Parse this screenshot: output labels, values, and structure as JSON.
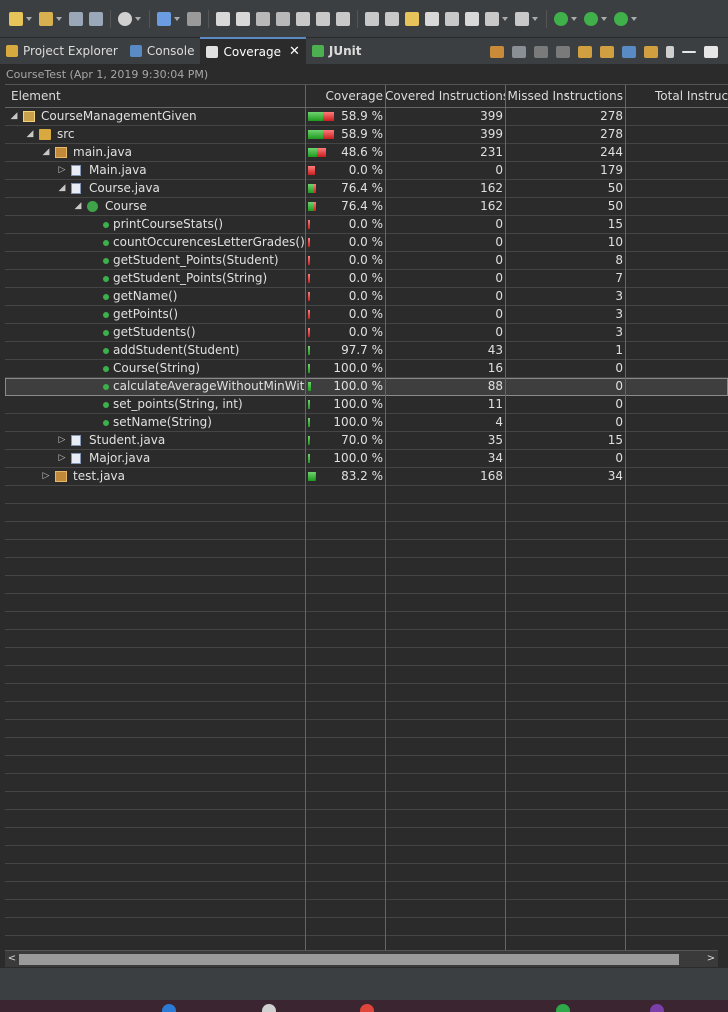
{
  "toolbar": {
    "icons": [
      "new-icon",
      "new-package-icon",
      "save-icon",
      "save-all-icon",
      "user-icon",
      "console-icon",
      "skip-breakpoints-icon",
      "resume-icon",
      "suspend-icon",
      "terminate-icon",
      "disconnect-icon",
      "step-into-icon",
      "step-over-icon",
      "step-return-icon",
      "toggle-source-icon",
      "open-task-icon",
      "toggle-mark-icon",
      "edit-icon",
      "external-tools-icon",
      "open-type-icon",
      "open-file-icon",
      "whitespace-icon",
      "run-coverage-icon",
      "run-icon",
      "debug-icon"
    ]
  },
  "tabs": [
    {
      "label": "Project Explorer",
      "icon": "project-explorer-icon",
      "color": "#d7a93f",
      "active": false
    },
    {
      "label": "Console",
      "icon": "console-icon",
      "color": "#5a8ac6",
      "active": false
    },
    {
      "label": "Coverage",
      "icon": "coverage-icon",
      "color": "#e0e0e0",
      "active": true,
      "close": "✕"
    },
    {
      "label": "JUnit",
      "icon": "junit-icon",
      "color": "#4caf50",
      "active": false
    }
  ],
  "session": "CourseTest (Apr 1, 2019 9:30:04 PM)",
  "columns": {
    "element": "Element",
    "coverage": "Coverage",
    "covered": "Covered Instructions",
    "missed": "Missed Instructions",
    "total": "Total Instruc"
  },
  "colors": {
    "covered": "#2ea82e",
    "missed": "#e03c3c",
    "selection": "#3e3e3e"
  },
  "rows": [
    {
      "name": "CourseManagementGiven",
      "level": 0,
      "expander": "expanded",
      "icon": "project",
      "coverage": "58.9 %",
      "covered": "399",
      "missed": "278",
      "selected": false
    },
    {
      "name": "src",
      "level": 1,
      "expander": "expanded",
      "icon": "folder",
      "coverage": "58.9 %",
      "covered": "399",
      "missed": "278",
      "selected": false
    },
    {
      "name": "main.java",
      "level": 2,
      "expander": "expanded",
      "icon": "package",
      "coverage": "48.6 %",
      "covered": "231",
      "missed": "244",
      "selected": false
    },
    {
      "name": "Main.java",
      "level": 3,
      "expander": "collapsed",
      "icon": "file",
      "coverage": "0.0 %",
      "covered": "0",
      "missed": "179",
      "selected": false
    },
    {
      "name": "Course.java",
      "level": 3,
      "expander": "expanded",
      "icon": "file",
      "coverage": "76.4 %",
      "covered": "162",
      "missed": "50",
      "selected": false
    },
    {
      "name": "Course",
      "level": 4,
      "expander": "expanded",
      "icon": "class",
      "coverage": "76.4 %",
      "covered": "162",
      "missed": "50",
      "selected": false
    },
    {
      "name": "printCourseStats()",
      "level": 5,
      "expander": "none",
      "icon": "method",
      "coverage": "0.0 %",
      "covered": "0",
      "missed": "15",
      "selected": false
    },
    {
      "name": "countOccurencesLetterGrades()",
      "level": 5,
      "expander": "none",
      "icon": "method",
      "coverage": "0.0 %",
      "covered": "0",
      "missed": "10",
      "selected": false
    },
    {
      "name": "getStudent_Points(Student)",
      "level": 5,
      "expander": "none",
      "icon": "method",
      "coverage": "0.0 %",
      "covered": "0",
      "missed": "8",
      "selected": false
    },
    {
      "name": "getStudent_Points(String)",
      "level": 5,
      "expander": "none",
      "icon": "method",
      "coverage": "0.0 %",
      "covered": "0",
      "missed": "7",
      "selected": false
    },
    {
      "name": "getName()",
      "level": 5,
      "expander": "none",
      "icon": "method",
      "coverage": "0.0 %",
      "covered": "0",
      "missed": "3",
      "selected": false
    },
    {
      "name": "getPoints()",
      "level": 5,
      "expander": "none",
      "icon": "method",
      "coverage": "0.0 %",
      "covered": "0",
      "missed": "3",
      "selected": false
    },
    {
      "name": "getStudents()",
      "level": 5,
      "expander": "none",
      "icon": "method",
      "coverage": "0.0 %",
      "covered": "0",
      "missed": "3",
      "selected": false
    },
    {
      "name": "addStudent(Student)",
      "level": 5,
      "expander": "none",
      "icon": "method",
      "coverage": "97.7 %",
      "covered": "43",
      "missed": "1",
      "selected": false
    },
    {
      "name": "Course(String)",
      "level": 5,
      "expander": "none",
      "icon": "method",
      "coverage": "100.0 %",
      "covered": "16",
      "missed": "0",
      "selected": false
    },
    {
      "name": "calculateAverageWithoutMinWith",
      "level": 5,
      "expander": "none",
      "icon": "method",
      "coverage": "100.0 %",
      "covered": "88",
      "missed": "0",
      "selected": true
    },
    {
      "name": "set_points(String, int)",
      "level": 5,
      "expander": "none",
      "icon": "method",
      "coverage": "100.0 %",
      "covered": "11",
      "missed": "0",
      "selected": false
    },
    {
      "name": "setName(String)",
      "level": 5,
      "expander": "none",
      "icon": "method",
      "coverage": "100.0 %",
      "covered": "4",
      "missed": "0",
      "selected": false
    },
    {
      "name": "Student.java",
      "level": 3,
      "expander": "collapsed",
      "icon": "file",
      "coverage": "70.0 %",
      "covered": "35",
      "missed": "15",
      "selected": false
    },
    {
      "name": "Major.java",
      "level": 3,
      "expander": "collapsed",
      "icon": "file",
      "coverage": "100.0 %",
      "covered": "34",
      "missed": "0",
      "selected": false
    },
    {
      "name": "test.java",
      "level": 2,
      "expander": "collapsed",
      "icon": "package",
      "coverage": "83.2 %",
      "covered": "168",
      "missed": "34",
      "selected": false
    }
  ],
  "scrollbar": {
    "left": "<",
    "right": ">"
  }
}
